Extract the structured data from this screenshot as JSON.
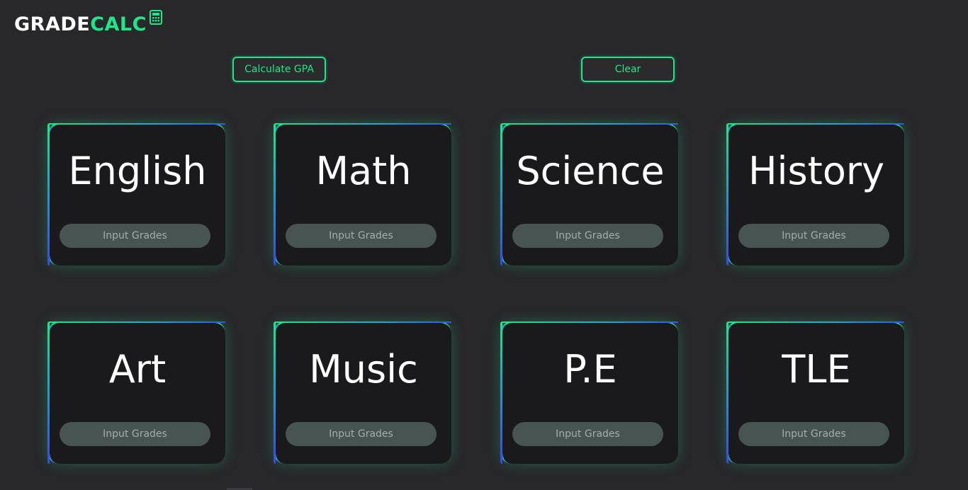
{
  "logo": {
    "part1": "GRADE",
    "part2": "CALC",
    "icon": "calculator-icon",
    "accent": "#1de78a"
  },
  "actions": {
    "calculate_label": "Calculate GPA",
    "clear_label": "Clear"
  },
  "subjects": [
    {
      "name": "English",
      "button": "Input Grades"
    },
    {
      "name": "Math",
      "button": "Input Grades"
    },
    {
      "name": "Science",
      "button": "Input Grades"
    },
    {
      "name": "History",
      "button": "Input Grades"
    },
    {
      "name": "Art",
      "button": "Input Grades"
    },
    {
      "name": "Music",
      "button": "Input Grades"
    },
    {
      "name": "P.E",
      "button": "Input Grades"
    },
    {
      "name": "TLE",
      "button": "Input Grades"
    }
  ],
  "colors": {
    "background": "#28272a",
    "card": "#1a191c",
    "accent": "#1de78a",
    "input_button": "#475452"
  }
}
